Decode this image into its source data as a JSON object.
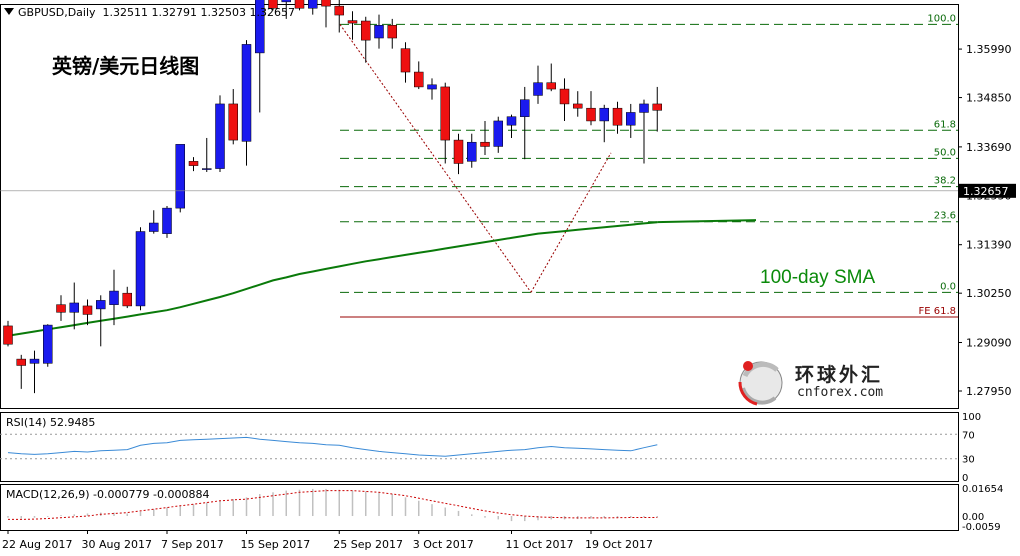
{
  "header": {
    "symbol": "GBPUSD,Daily",
    "ohlc": "1.32511 1.32791 1.32503 1.32657"
  },
  "title_cn": "英镑/美元日线图",
  "sma_label": "100-day SMA",
  "watermark": {
    "title": "环球外汇",
    "url": "cnforex.com"
  },
  "colors": {
    "bull": "#1a1aee",
    "bear": "#ee1111",
    "sma": "#0a7a0a",
    "fib": "#0a6a0a",
    "fe": "#990000",
    "rsi": "#3a8ad6",
    "macd_signal": "#cc0000",
    "macd_hist": "#c0c0c0"
  },
  "chart_data": {
    "type": "candlestick",
    "price_axis_ticks": [
      "1.35990",
      "1.34850",
      "1.33690",
      "1.32550",
      "1.31390",
      "1.30250",
      "1.29090",
      "1.27950"
    ],
    "last_price": "1.32657",
    "x_tick_labels": [
      "22 Aug 2017",
      "30 Aug 2017",
      "7 Sep 2017",
      "15 Sep 2017",
      "25 Sep 2017",
      "3 Oct 2017",
      "11 Oct 2017",
      "19 Oct 2017"
    ],
    "candles": [
      {
        "o": 1.2948,
        "h": 1.296,
        "l": 1.29,
        "c": 1.2905
      },
      {
        "o": 1.287,
        "h": 1.288,
        "l": 1.28,
        "c": 1.2855
      },
      {
        "o": 1.286,
        "h": 1.289,
        "l": 1.279,
        "c": 1.287
      },
      {
        "o": 1.286,
        "h": 1.2952,
        "l": 1.2852,
        "c": 1.295
      },
      {
        "o": 1.2998,
        "h": 1.302,
        "l": 1.296,
        "c": 1.298
      },
      {
        "o": 1.298,
        "h": 1.305,
        "l": 1.294,
        "c": 1.3002
      },
      {
        "o": 1.2995,
        "h": 1.301,
        "l": 1.295,
        "c": 1.2975
      },
      {
        "o": 1.2988,
        "h": 1.302,
        "l": 1.29,
        "c": 1.3008
      },
      {
        "o": 1.2998,
        "h": 1.308,
        "l": 1.295,
        "c": 1.303
      },
      {
        "o": 1.3025,
        "h": 1.304,
        "l": 1.299,
        "c": 1.2995
      },
      {
        "o": 1.2995,
        "h": 1.318,
        "l": 1.2985,
        "c": 1.317
      },
      {
        "o": 1.317,
        "h": 1.322,
        "l": 1.3165,
        "c": 1.319
      },
      {
        "o": 1.3165,
        "h": 1.323,
        "l": 1.3155,
        "c": 1.3225
      },
      {
        "o": 1.3225,
        "h": 1.328,
        "l": 1.3215,
        "c": 1.3375
      },
      {
        "o": 1.3335,
        "h": 1.3345,
        "l": 1.3312,
        "c": 1.3325
      },
      {
        "o": 1.3318,
        "h": 1.339,
        "l": 1.331,
        "c": 1.3318
      },
      {
        "o": 1.3318,
        "h": 1.349,
        "l": 1.331,
        "c": 1.347
      },
      {
        "o": 1.347,
        "h": 1.3505,
        "l": 1.3375,
        "c": 1.3385
      },
      {
        "o": 1.3382,
        "h": 1.362,
        "l": 1.3325,
        "c": 1.361
      },
      {
        "o": 1.359,
        "h": 1.3655,
        "l": 1.345,
        "c": 1.3815
      },
      {
        "o": 1.3745,
        "h": 1.3742,
        "l": 1.369,
        "c": 1.3695
      },
      {
        "o": 1.371,
        "h": 1.3785,
        "l": 1.367,
        "c": 1.3715
      },
      {
        "o": 1.3715,
        "h": 1.372,
        "l": 1.369,
        "c": 1.3695
      },
      {
        "o": 1.3695,
        "h": 1.385,
        "l": 1.368,
        "c": 1.382
      },
      {
        "o": 1.381,
        "h": 1.383,
        "l": 1.365,
        "c": 1.37
      },
      {
        "o": 1.37,
        "h": 1.372,
        "l": 1.3638,
        "c": 1.3679
      },
      {
        "o": 1.3666,
        "h": 1.3688,
        "l": 1.3621,
        "c": 1.366
      },
      {
        "o": 1.3665,
        "h": 1.3675,
        "l": 1.3567,
        "c": 1.362
      },
      {
        "o": 1.3625,
        "h": 1.368,
        "l": 1.36,
        "c": 1.3655
      },
      {
        "o": 1.3655,
        "h": 1.367,
        "l": 1.36,
        "c": 1.3625
      },
      {
        "o": 1.36,
        "h": 1.3615,
        "l": 1.352,
        "c": 1.3545
      },
      {
        "o": 1.3545,
        "h": 1.357,
        "l": 1.3505,
        "c": 1.351
      },
      {
        "o": 1.3505,
        "h": 1.353,
        "l": 1.348,
        "c": 1.3515
      },
      {
        "o": 1.351,
        "h": 1.352,
        "l": 1.333,
        "c": 1.3385
      },
      {
        "o": 1.3385,
        "h": 1.34,
        "l": 1.3305,
        "c": 1.333
      },
      {
        "o": 1.3335,
        "h": 1.34,
        "l": 1.332,
        "c": 1.338
      },
      {
        "o": 1.338,
        "h": 1.343,
        "l": 1.335,
        "c": 1.337
      },
      {
        "o": 1.337,
        "h": 1.344,
        "l": 1.3355,
        "c": 1.343
      },
      {
        "o": 1.342,
        "h": 1.3445,
        "l": 1.339,
        "c": 1.344
      },
      {
        "o": 1.344,
        "h": 1.351,
        "l": 1.334,
        "c": 1.348
      },
      {
        "o": 1.349,
        "h": 1.356,
        "l": 1.347,
        "c": 1.352
      },
      {
        "o": 1.352,
        "h": 1.3565,
        "l": 1.35,
        "c": 1.3505
      },
      {
        "o": 1.3505,
        "h": 1.353,
        "l": 1.343,
        "c": 1.347
      },
      {
        "o": 1.347,
        "h": 1.35,
        "l": 1.344,
        "c": 1.346
      },
      {
        "o": 1.346,
        "h": 1.35,
        "l": 1.342,
        "c": 1.343
      },
      {
        "o": 1.343,
        "h": 1.3468,
        "l": 1.338,
        "c": 1.346
      },
      {
        "o": 1.346,
        "h": 1.3475,
        "l": 1.34,
        "c": 1.342
      },
      {
        "o": 1.342,
        "h": 1.347,
        "l": 1.339,
        "c": 1.345
      },
      {
        "o": 1.345,
        "h": 1.348,
        "l": 1.333,
        "c": 1.347
      },
      {
        "o": 1.347,
        "h": 1.351,
        "l": 1.3405,
        "c": 1.3455
      }
    ],
    "sma_100": [
      1.2925,
      1.293,
      1.2935,
      1.294,
      1.2945,
      1.295,
      1.2955,
      1.296,
      1.2965,
      1.297,
      1.2975,
      1.298,
      1.2985,
      1.2992,
      1.3,
      1.3008,
      1.3016,
      1.3025,
      1.3035,
      1.3045,
      1.3055,
      1.3062,
      1.307,
      1.3076,
      1.3082,
      1.3088,
      1.3094,
      1.31,
      1.3105,
      1.311,
      1.3115,
      1.312,
      1.3125,
      1.313,
      1.3135,
      1.314,
      1.3145,
      1.315,
      1.3155,
      1.316,
      1.3165,
      1.3168,
      1.3171,
      1.3174,
      1.3177,
      1.318,
      1.3183,
      1.3186,
      1.3189,
      1.3192
    ],
    "fibonacci": {
      "high": 1.3657,
      "low": 1.3027,
      "levels": [
        {
          "label": "100.0",
          "price": 1.3657
        },
        {
          "label": "61.8",
          "price": 1.3408
        },
        {
          "label": "50.0",
          "price": 1.3342
        },
        {
          "label": "38.2",
          "price": 1.32757
        },
        {
          "label": "23.6",
          "price": 1.3193
        },
        {
          "label": "0.0",
          "price": 1.3027
        }
      ],
      "fe_label": "FE 61.8",
      "fe_price": 1.2969
    },
    "rsi": {
      "label": "RSI(14) 52.9485",
      "axis_ticks": [
        "100",
        "70",
        "30",
        "0"
      ],
      "values": [
        40,
        38,
        37,
        38,
        40,
        42,
        41,
        43,
        44,
        45,
        52,
        55,
        56,
        60,
        61,
        62,
        63,
        64,
        65,
        62,
        60,
        58,
        56,
        55,
        53,
        52,
        48,
        45,
        42,
        40,
        38,
        36,
        35,
        34,
        36,
        38,
        40,
        42,
        44,
        45,
        48,
        50,
        48,
        47,
        46,
        45,
        44,
        43,
        48,
        53
      ]
    },
    "macd": {
      "label": "MACD(12,26,9) -0.000779 -0.000884",
      "axis_ticks": [
        "0.01654",
        "0.00",
        "-0.0059"
      ],
      "histogram": [
        -0.001,
        -0.0015,
        -0.001,
        0,
        0.0005,
        0.001,
        0.0015,
        0.002,
        0.002,
        0.0015,
        0.0025,
        0.004,
        0.005,
        0.006,
        0.007,
        0.008,
        0.009,
        0.01,
        0.011,
        0.013,
        0.014,
        0.015,
        0.0155,
        0.016,
        0.016,
        0.0155,
        0.015,
        0.0145,
        0.014,
        0.013,
        0.011,
        0.009,
        0.007,
        0.005,
        0.003,
        0.001,
        -0.001,
        -0.002,
        -0.003,
        -0.003,
        -0.0025,
        -0.002,
        -0.002,
        -0.0018,
        -0.0015,
        -0.0012,
        -0.001,
        -0.0009,
        -0.0008,
        -0.0008
      ],
      "signal": [
        -0.002,
        -0.002,
        -0.0018,
        -0.0015,
        -0.001,
        -0.0005,
        0,
        0.001,
        0.0015,
        0.002,
        0.003,
        0.004,
        0.005,
        0.006,
        0.007,
        0.008,
        0.009,
        0.0095,
        0.01,
        0.011,
        0.012,
        0.013,
        0.014,
        0.0145,
        0.015,
        0.015,
        0.015,
        0.0145,
        0.014,
        0.013,
        0.012,
        0.0105,
        0.009,
        0.0075,
        0.006,
        0.0045,
        0.003,
        0.0018,
        0.0008,
        0,
        -0.0005,
        -0.0008,
        -0.001,
        -0.0011,
        -0.0011,
        -0.0011,
        -0.001,
        -0.0009,
        -0.0009,
        -0.0009
      ]
    }
  }
}
